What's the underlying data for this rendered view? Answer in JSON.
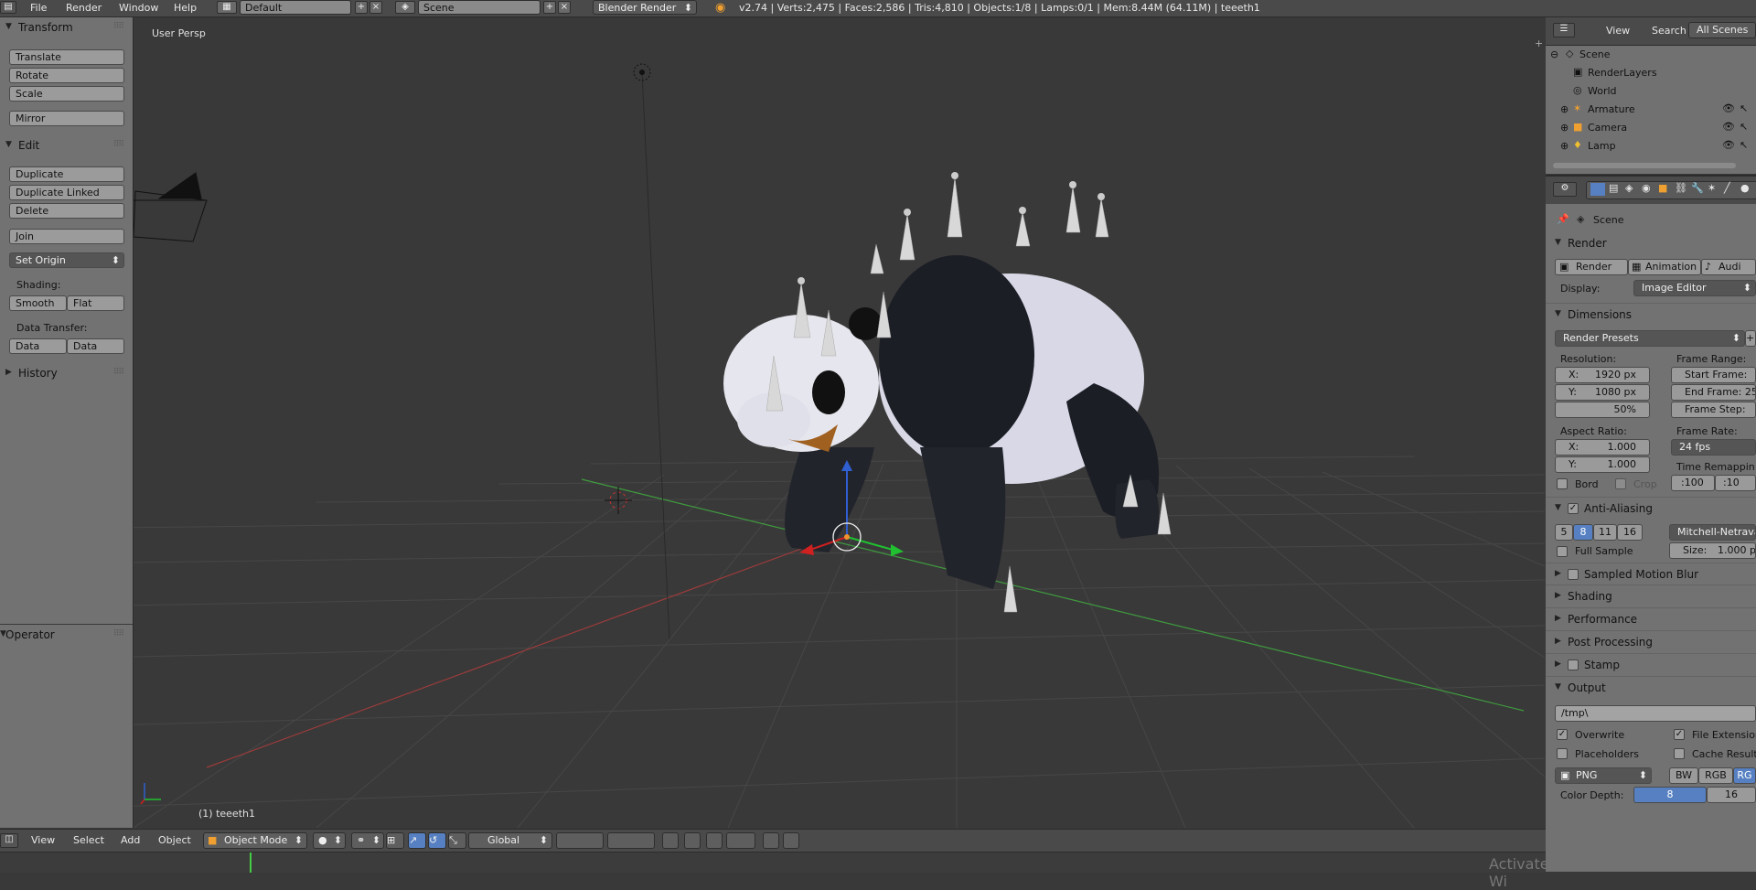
{
  "top": {
    "menu": [
      "File",
      "Render",
      "Window",
      "Help"
    ],
    "layout": "Default",
    "scene": "Scene",
    "engine": "Blender Render",
    "stats": "v2.74 | Verts:2,475 | Faces:2,586 | Tris:4,810 | Objects:1/8 | Lamps:0/1 | Mem:8.44M (64.11M) | teeeth1"
  },
  "toolshelf": {
    "transform_title": "Transform",
    "translate": "Translate",
    "rotate": "Rotate",
    "scale": "Scale",
    "mirror": "Mirror",
    "edit_title": "Edit",
    "duplicate": "Duplicate",
    "duplicate_linked": "Duplicate Linked",
    "delete": "Delete",
    "join": "Join",
    "set_origin": "Set Origin",
    "shading_label": "Shading:",
    "smooth": "Smooth",
    "flat": "Flat",
    "data_transfer_label": "Data Transfer:",
    "data": "Data",
    "data_layo": "Data Layo",
    "history_title": "History",
    "operator_title": "Operator"
  },
  "viewport": {
    "view_name": "User Persp",
    "object_label": "(1) teeeth1",
    "watermark": "Activate Wi"
  },
  "bottombar": {
    "view": "View",
    "select": "Select",
    "add": "Add",
    "object": "Object",
    "mode": "Object Mode",
    "orientation": "Global"
  },
  "outliner": {
    "view": "View",
    "search": "Search",
    "filter": "All Scenes",
    "items": [
      "Scene",
      "RenderLayers",
      "World",
      "Armature",
      "Camera",
      "Lamp"
    ]
  },
  "properties": {
    "context": "Scene",
    "render_title": "Render",
    "render_btn": "Render",
    "animation_btn": "Animation",
    "audio_btn": "Audi",
    "display_label": "Display:",
    "display_value": "Image Editor",
    "dimensions_title": "Dimensions",
    "render_presets": "Render Presets",
    "resolution_label": "Resolution:",
    "res_x_label": "X:",
    "res_x": "1920 px",
    "res_y_label": "Y:",
    "res_y": "1080 px",
    "res_pct": "50%",
    "frame_range_label": "Frame Range:",
    "start_frame": "Start Frame:",
    "end_frame": "End Frame: 25",
    "frame_step": "Frame Step:",
    "aspect_label": "Aspect Ratio:",
    "aspect_x_label": "X:",
    "aspect_x": "1.000",
    "aspect_y_label": "Y:",
    "aspect_y": "1.000",
    "frame_rate_label": "Frame Rate:",
    "frame_rate": "24 fps",
    "time_remap_label": "Time Remappin",
    "remap_old": ":100",
    "remap_new": ":10",
    "bord": "Bord",
    "crop": "Crop",
    "aa_title": "Anti-Aliasing",
    "aa_5": "5",
    "aa_8": "8",
    "aa_11": "11",
    "aa_16": "16",
    "aa_filter": "Mitchell-Netrava",
    "full_sample": "Full Sample",
    "size_label": "Size:",
    "size_value": "1.000 p",
    "motion_blur": "Sampled Motion Blur",
    "shading": "Shading",
    "performance": "Performance",
    "post_processing": "Post Processing",
    "stamp": "Stamp",
    "output_title": "Output",
    "output_path": "/tmp\\",
    "overwrite": "Overwrite",
    "file_extensions": "File Extension",
    "placeholders": "Placeholders",
    "cache_result": "Cache Result",
    "format": "PNG",
    "bw": "BW",
    "rgb": "RGB",
    "rgba": "RG",
    "color_depth_label": "Color Depth:",
    "depth_8": "8",
    "depth_16": "16"
  }
}
